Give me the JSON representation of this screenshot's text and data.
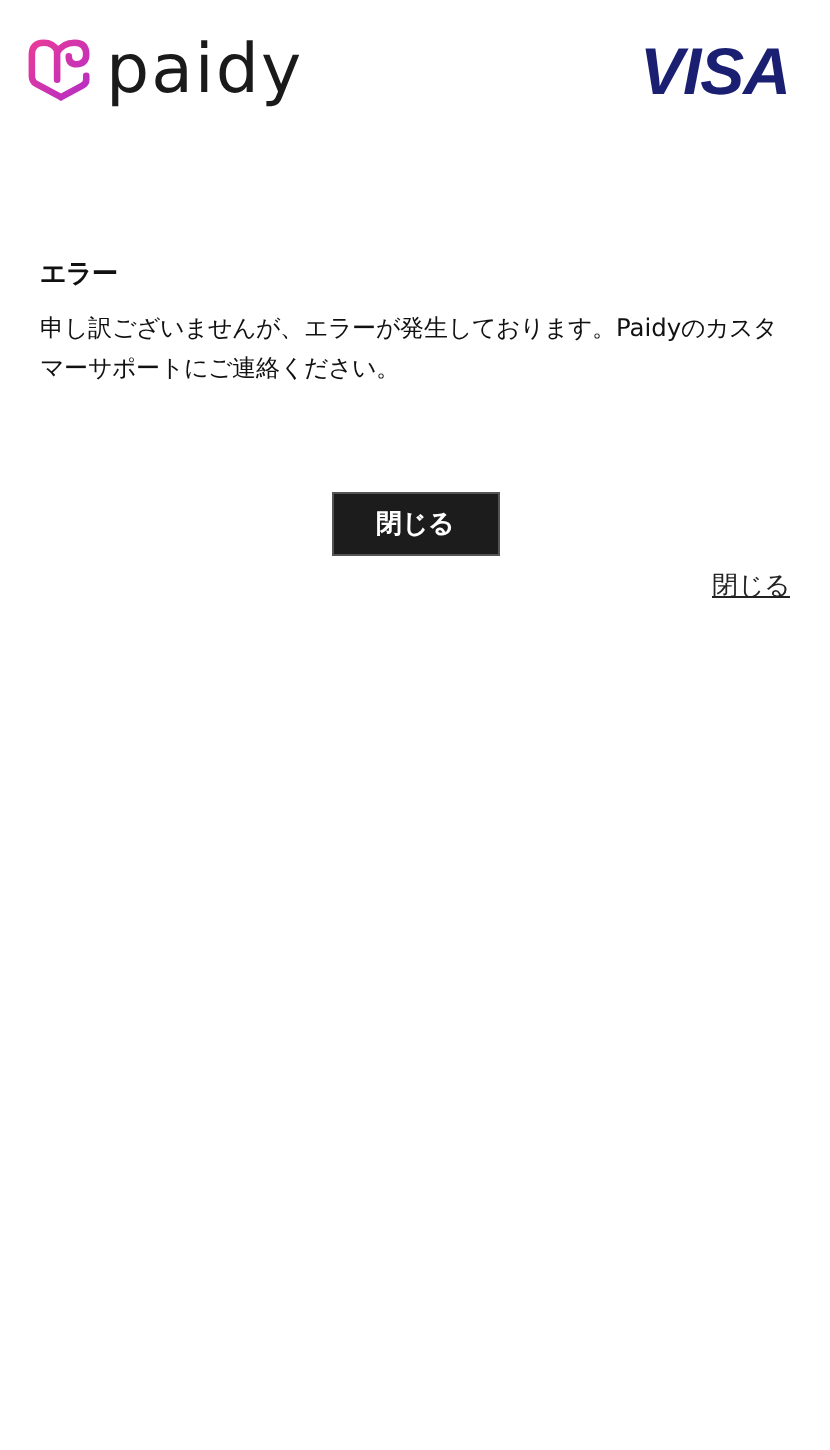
{
  "header": {
    "brand": "paidy",
    "card_brand": "VISA"
  },
  "error": {
    "title": "エラー",
    "message": "申し訳ございませんが、エラーが発生しております。Paidyのカスタマーサポートにご連絡ください。"
  },
  "buttons": [
    {
      "label": "閉じる",
      "kind": "primary"
    },
    {
      "label": "閉じる",
      "kind": "link"
    }
  ]
}
